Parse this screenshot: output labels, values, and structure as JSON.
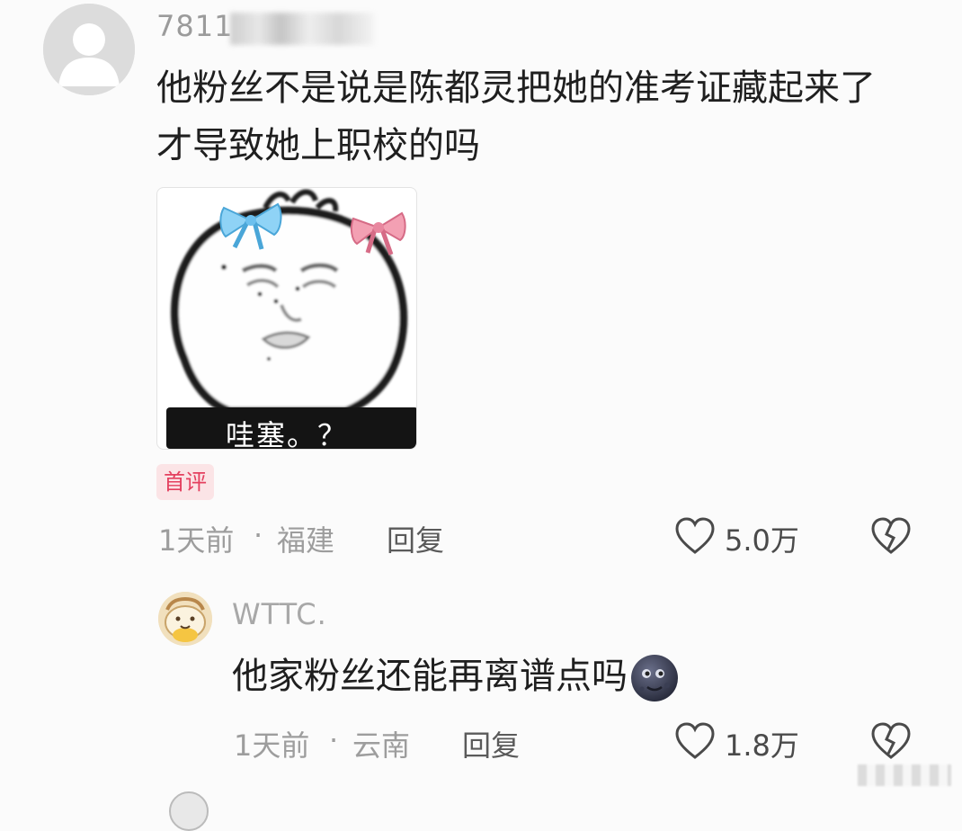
{
  "comments": [
    {
      "username": "7811",
      "text": "他粉丝不是说是陈都灵把她的准考证藏起来了才导致她上职校的吗",
      "meme_caption": "哇塞。？",
      "badge": "首评",
      "time": "1天前",
      "separator": "·",
      "location": "福建",
      "reply_label": "回复",
      "likes": "5.0万"
    },
    {
      "username": "WTTC.",
      "text": "他家粉丝还能再离谱点吗",
      "time": "1天前",
      "separator": "·",
      "location": "云南",
      "reply_label": "回复",
      "likes": "1.8万"
    }
  ],
  "icons": {
    "like": "heart-outline-icon",
    "dislike": "broken-heart-icon",
    "emoji": "new-moon-face-icon"
  },
  "colors": {
    "badge_text": "#e4405f",
    "badge_bg": "#fbe4e6",
    "meta_text": "#9d9d9d",
    "body_text": "#1f1f1f"
  }
}
